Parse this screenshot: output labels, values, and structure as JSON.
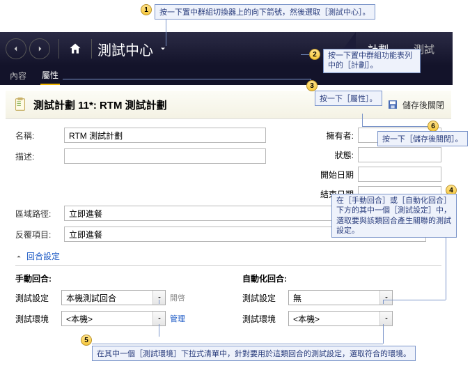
{
  "annotations": {
    "1": "按一下置中群組切換器上的向下箭號，然後選取［測試中心］。",
    "2": "按一下置中群組功能表列中的［計劃］。",
    "3": "按一下［屬性］。",
    "4": "在［手動回合］或［自動化回合］下方的其中一個［測試設定］中，選取要與該類回合產生關聯的測試設定。",
    "5": "在其中一個［測試環境］下拉式清單中，針對要用於這類回合的測試設定，選取符合的環境。",
    "6": "按一下［儲存後關閉］。"
  },
  "titlebar": {
    "title": "測試中心"
  },
  "toptabs": {
    "plan": "計劃",
    "test": "測試"
  },
  "subtabs": {
    "content": "內容",
    "properties": "屬性"
  },
  "page": {
    "title": "測試計劃 11*: RTM 測試計劃",
    "saveclose": "儲存後關閉"
  },
  "form": {
    "name_lbl": "名稱:",
    "name_val": "RTM 測試計劃",
    "desc_lbl": "描述:",
    "owner_lbl": "擁有者:",
    "state_lbl": "狀態:",
    "start_lbl": "開始日期",
    "end_lbl": "結束日期",
    "area_lbl": "區域路徑:",
    "area_val": "立即進餐",
    "iter_lbl": "反覆項目:",
    "iter_val": "立即進餐"
  },
  "section": {
    "runsettings": "回合設定"
  },
  "runs": {
    "manual_h": "手動回合:",
    "auto_h": "自動化回合:",
    "setting_lbl": "測試設定",
    "env_lbl": "測試環境",
    "manual_setting": "本機測試回合",
    "auto_setting": "無",
    "env_val": "<本機>",
    "open": "開啓",
    "manage": "管理"
  }
}
